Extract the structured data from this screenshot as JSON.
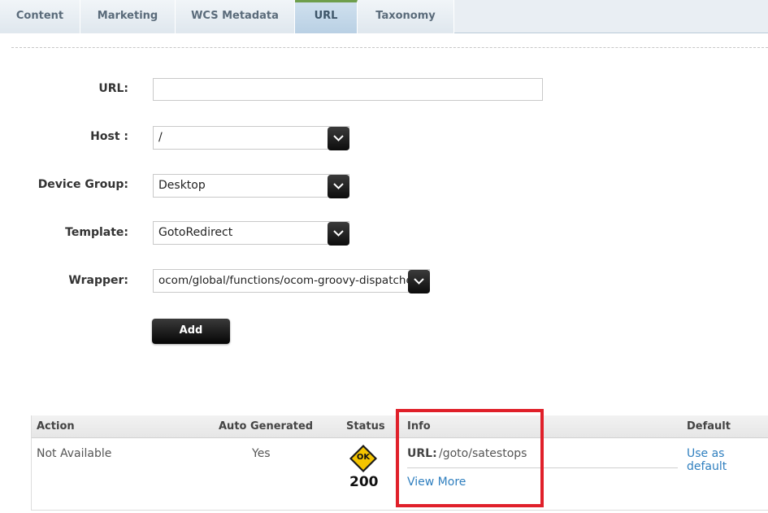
{
  "tabs": [
    {
      "label": "Content",
      "active": false
    },
    {
      "label": "Marketing",
      "active": false
    },
    {
      "label": "WCS Metadata",
      "active": false
    },
    {
      "label": "URL",
      "active": true
    },
    {
      "label": "Taxonomy",
      "active": false
    }
  ],
  "form": {
    "url_label": "URL:",
    "url_value": "",
    "host_label": "Host :",
    "host_value": "/",
    "device_group_label": "Device Group:",
    "device_group_value": "Desktop",
    "template_label": "Template:",
    "template_value": "GotoRedirect",
    "wrapper_label": "Wrapper:",
    "wrapper_value": "ocom/global/functions/ocom-groovy-dispatcher",
    "add_label": "Add"
  },
  "table": {
    "headers": {
      "action": "Action",
      "auto_generated": "Auto Generated",
      "status": "Status",
      "info": "Info",
      "default": "Default"
    },
    "row": {
      "action": "Not Available",
      "auto_generated": "Yes",
      "status_badge": "OK",
      "status_code": "200",
      "info_url_label": "URL:",
      "info_url_value": "/goto/satestops",
      "view_more": "View More",
      "use_default": "Use as default"
    }
  },
  "colors": {
    "active_tab_accent": "#6e9e4c",
    "highlight_border": "#e0202a",
    "link": "#2f7fbf",
    "ok_badge": "#f4c400"
  }
}
